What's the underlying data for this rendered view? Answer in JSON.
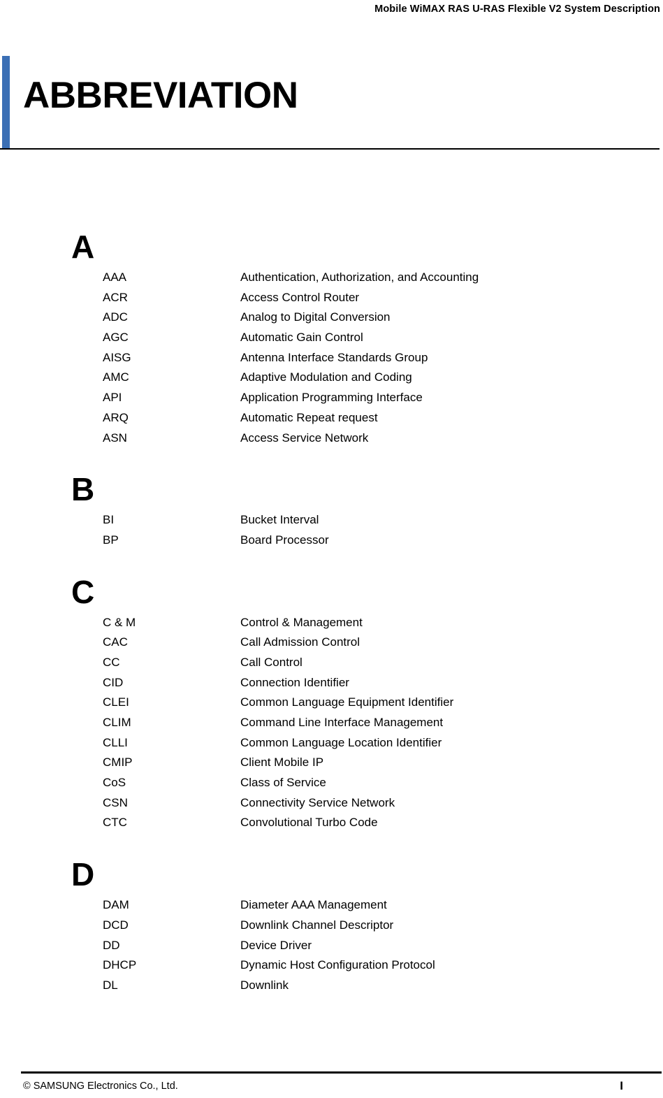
{
  "header": {
    "running_title": "Mobile WiMAX RAS U-RAS Flexible V2 System Description"
  },
  "title_block": {
    "chapter_title": "ABBREVIATION",
    "accent_color": "#3b6fb5"
  },
  "glossary": {
    "sections": [
      {
        "letter": "A",
        "entries": [
          {
            "term": "AAA",
            "definition": "Authentication, Authorization, and Accounting"
          },
          {
            "term": "ACR",
            "definition": "Access Control Router"
          },
          {
            "term": "ADC",
            "definition": "Analog to Digital Conversion"
          },
          {
            "term": "AGC",
            "definition": "Automatic Gain Control"
          },
          {
            "term": "AISG",
            "definition": "Antenna Interface Standards Group"
          },
          {
            "term": "AMC",
            "definition": "Adaptive Modulation and Coding"
          },
          {
            "term": "API",
            "definition": "Application Programming Interface"
          },
          {
            "term": "ARQ",
            "definition": "Automatic Repeat request"
          },
          {
            "term": "ASN",
            "definition": "Access Service Network"
          }
        ]
      },
      {
        "letter": "B",
        "entries": [
          {
            "term": "BI",
            "definition": "Bucket Interval"
          },
          {
            "term": "BP",
            "definition": "Board Processor"
          }
        ]
      },
      {
        "letter": "C",
        "entries": [
          {
            "term": "C & M",
            "definition": "Control & Management"
          },
          {
            "term": "CAC",
            "definition": "Call Admission Control"
          },
          {
            "term": "CC",
            "definition": "Call Control"
          },
          {
            "term": "CID",
            "definition": "Connection Identifier"
          },
          {
            "term": "CLEI",
            "definition": "Common Language Equipment Identifier"
          },
          {
            "term": "CLIM",
            "definition": "Command Line Interface Management"
          },
          {
            "term": "CLLI",
            "definition": "Common Language Location Identifier"
          },
          {
            "term": "CMIP",
            "definition": "Client Mobile IP"
          },
          {
            "term": "CoS",
            "definition": "Class of Service"
          },
          {
            "term": "CSN",
            "definition": "Connectivity Service Network"
          },
          {
            "term": "CTC",
            "definition": "Convolutional Turbo Code"
          }
        ]
      },
      {
        "letter": "D",
        "entries": [
          {
            "term": "DAM",
            "definition": "Diameter AAA Management"
          },
          {
            "term": "DCD",
            "definition": "Downlink Channel Descriptor"
          },
          {
            "term": "DD",
            "definition": "Device Driver"
          },
          {
            "term": "DHCP",
            "definition": "Dynamic Host Configuration Protocol"
          },
          {
            "term": "DL",
            "definition": "Downlink"
          }
        ]
      }
    ]
  },
  "footer": {
    "copyright": "© SAMSUNG Electronics Co., Ltd.",
    "page_number": "I"
  }
}
